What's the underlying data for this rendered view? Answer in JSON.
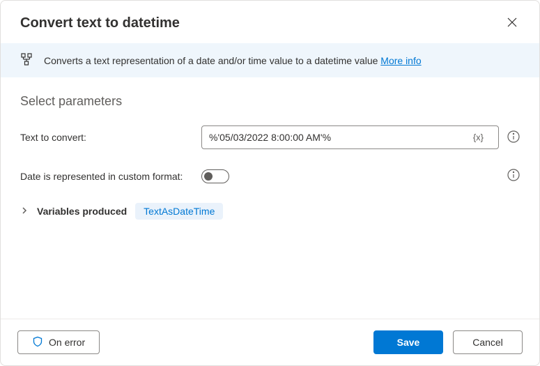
{
  "dialog": {
    "title": "Convert text to datetime"
  },
  "banner": {
    "text": "Converts a text representation of a date and/or time value to a datetime value ",
    "link": "More info"
  },
  "section": {
    "title": "Select parameters"
  },
  "fields": {
    "textToConvert": {
      "label": "Text to convert:",
      "value": "%'05/03/2022 8:00:00 AM'%",
      "varIcon": "{x}"
    },
    "customFormat": {
      "label": "Date is represented in custom format:",
      "value": false
    }
  },
  "variables": {
    "label": "Variables produced",
    "chip": "TextAsDateTime"
  },
  "footer": {
    "onError": "On error",
    "save": "Save",
    "cancel": "Cancel"
  }
}
